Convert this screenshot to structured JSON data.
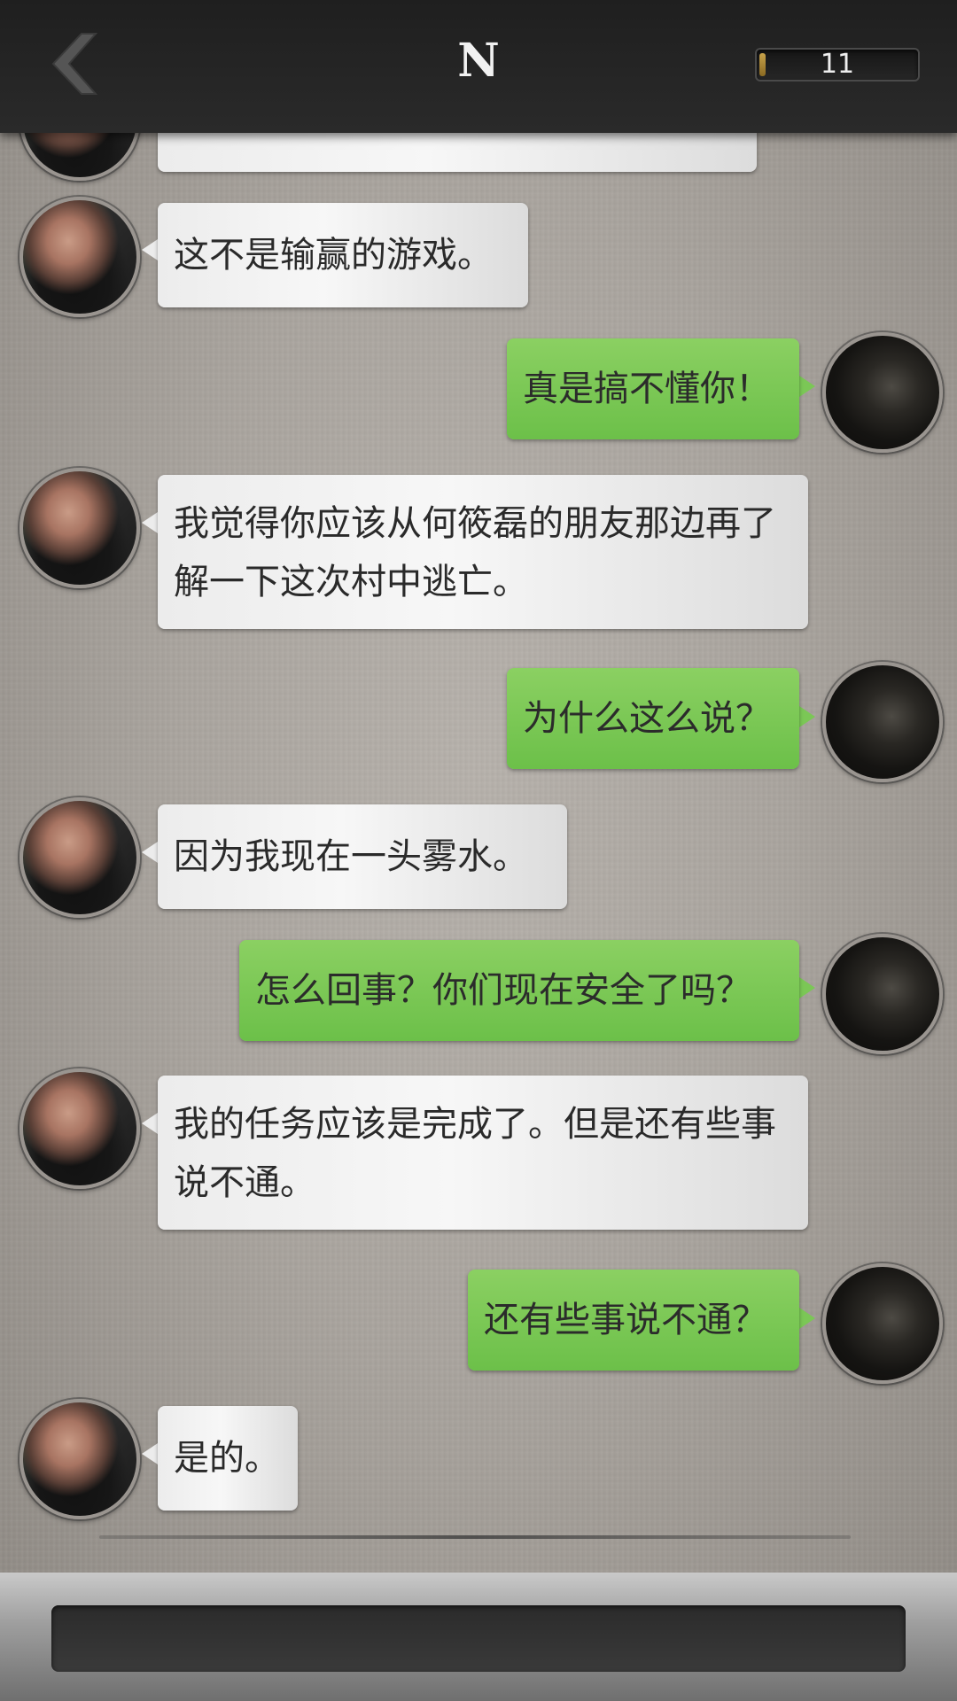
{
  "header": {
    "back_icon": "chevron-left-icon",
    "title": "N",
    "counter": {
      "value": "11",
      "fill_fraction": 0.04,
      "fill_color": "#b08d3c"
    }
  },
  "colors": {
    "header_bg": "#222222",
    "npc_bubble": "#eeeeee",
    "player_bubble": "#7cc653",
    "input_bar": "#333333"
  },
  "messages": [
    {
      "from": "npc",
      "text": "这不是输赢的游戏。"
    },
    {
      "from": "player",
      "text": "真是搞不懂你！"
    },
    {
      "from": "npc",
      "text": "我觉得你应该从何筱磊的朋友那边再了解一下这次村中逃亡。"
    },
    {
      "from": "player",
      "text": "为什么这么说？"
    },
    {
      "from": "npc",
      "text": "因为我现在一头雾水。"
    },
    {
      "from": "player",
      "text": "怎么回事？你们现在安全了吗？"
    },
    {
      "from": "npc",
      "text": "我的任务应该是完成了。但是还有些事说不通。"
    },
    {
      "from": "player",
      "text": "还有些事说不通？"
    },
    {
      "from": "npc",
      "text": "是的。"
    }
  ],
  "input": {
    "value": ""
  }
}
